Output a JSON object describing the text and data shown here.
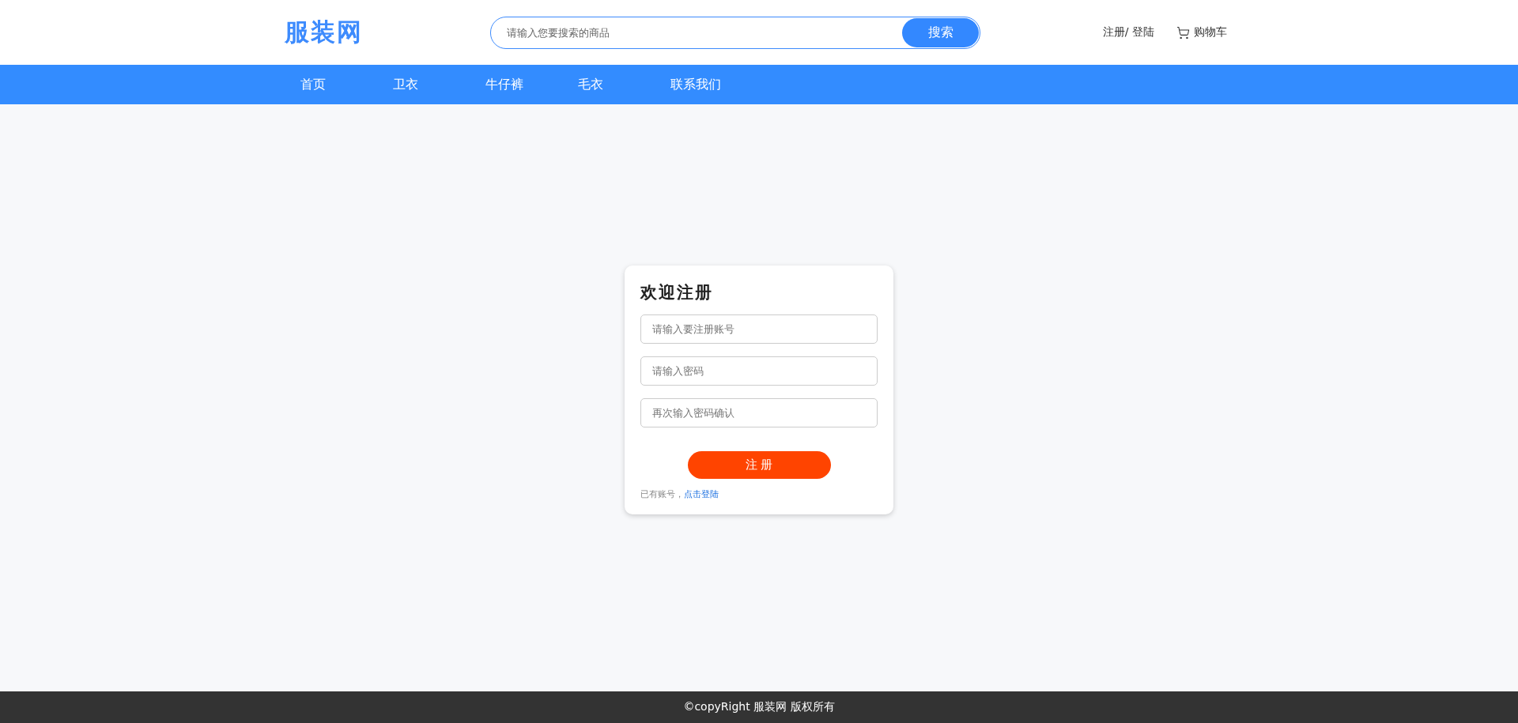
{
  "header": {
    "logo": "服装网",
    "search": {
      "placeholder": "请输入您要搜索的商品",
      "button": "搜索"
    },
    "account_link": "注册/ 登陆",
    "cart_link": "购物车"
  },
  "nav": [
    {
      "label": "首页"
    },
    {
      "label": "卫衣"
    },
    {
      "label": "牛仔裤"
    },
    {
      "label": "毛衣"
    },
    {
      "label": "联系我们"
    }
  ],
  "register": {
    "title": "欢迎注册",
    "fields": [
      {
        "placeholder": "请输入要注册账号"
      },
      {
        "placeholder": "请输入密码"
      },
      {
        "placeholder": "再次输入密码确认"
      }
    ],
    "button": "注 册",
    "login_prompt": "已有账号，",
    "login_link": "点击登陆"
  },
  "footer": "©copyRight 服装网 版权所有"
}
